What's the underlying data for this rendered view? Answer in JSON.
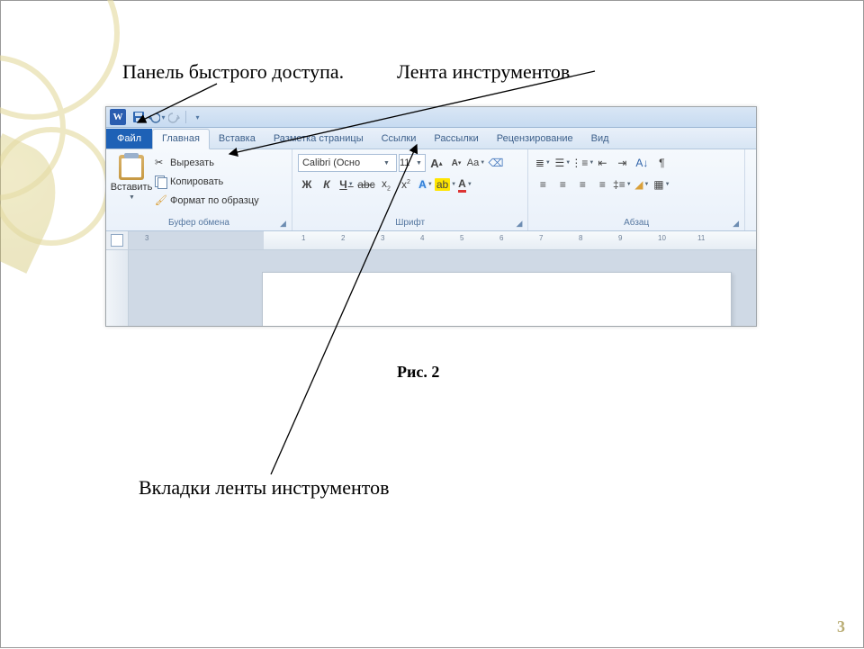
{
  "annotations": {
    "qat": "Панель быстрого доступа.",
    "ribbon": "Лента инструментов",
    "tabs": "Вкладки ленты инструментов"
  },
  "caption": "Рис. 2",
  "page_number": "3",
  "word": {
    "tabs": {
      "file": "Файл",
      "home": "Главная",
      "insert": "Вставка",
      "layout": "Разметка страницы",
      "refs": "Ссылки",
      "mail": "Рассылки",
      "review": "Рецензирование",
      "view": "Вид"
    },
    "clipboard": {
      "paste": "Вставить",
      "cut": "Вырезать",
      "copy": "Копировать",
      "format": "Формат по образцу",
      "title": "Буфер обмена"
    },
    "font": {
      "name": "Calibri (Осно",
      "size": "11",
      "title": "Шрифт",
      "bold": "Ж",
      "italic": "К",
      "underline": "Ч"
    },
    "paragraph": {
      "title": "Абзац"
    },
    "ruler": {
      "m3": "3",
      "n1": "1",
      "n2": "2",
      "n3": "3",
      "n4": "4",
      "n5": "5",
      "n6": "6",
      "n7": "7",
      "n8": "8",
      "n9": "9",
      "n10": "10",
      "n11": "11"
    }
  }
}
